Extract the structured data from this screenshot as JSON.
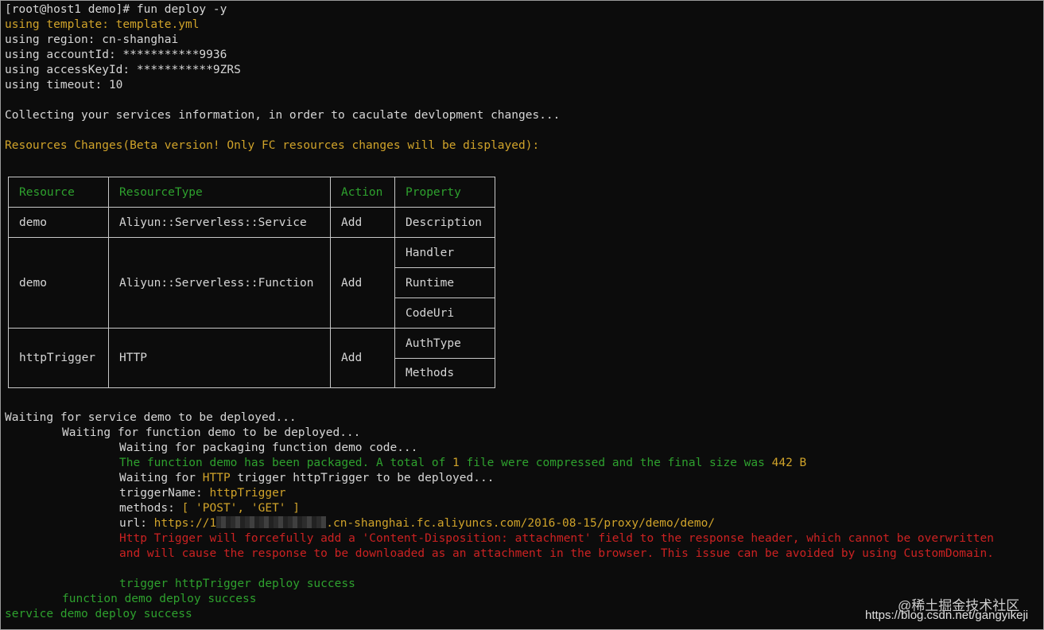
{
  "terminal": {
    "prompt": "[root@host1 demo]# fun deploy -y",
    "config_lines": [
      "using template: template.yml",
      "using region: cn-shanghai",
      "using accountId: ***********9936",
      "using accessKeyId: ***********9ZRS",
      "using timeout: 10"
    ],
    "collecting": "Collecting your services information, in order to caculate devlopment changes...",
    "resources_changes": "Resources Changes(Beta version! Only FC resources changes will be displayed):",
    "table": {
      "headers": [
        "Resource",
        "ResourceType",
        "Action",
        "Property"
      ],
      "rows": [
        {
          "resource": "demo",
          "type": "Aliyun::Serverless::Service",
          "action": "Add",
          "properties": [
            "Description"
          ]
        },
        {
          "resource": "demo",
          "type": "Aliyun::Serverless::Function",
          "action": "Add",
          "properties": [
            "Handler",
            "Runtime",
            "CodeUri"
          ]
        },
        {
          "resource": "httpTrigger",
          "type": "HTTP",
          "action": "Add",
          "properties": [
            "AuthType",
            "Methods"
          ]
        }
      ]
    },
    "deploy": {
      "wait_service": "Waiting for service demo to be deployed...",
      "wait_function": "Waiting for function demo to be deployed...",
      "wait_packaging": "Waiting for packaging function demo code...",
      "packaged_pre": "The function demo has been packaged. A total of ",
      "packaged_count": "1",
      "packaged_mid": " file were compressed and the final size was ",
      "packaged_size": "442 B",
      "wait_trigger_pre": "Waiting for ",
      "wait_trigger_type": "HTTP",
      "wait_trigger_post": " trigger httpTrigger to be deployed...",
      "trigger_name_label": "triggerName: ",
      "trigger_name_value": "httpTrigger",
      "methods_label": "methods: ",
      "methods_value": "[ 'POST', 'GET' ]",
      "url_label": "url: ",
      "url_prefix": "https://1",
      "url_suffix": ".cn-shanghai.fc.aliyuncs.com/2016-08-15/proxy/demo/demo/",
      "warning_1": "Http Trigger will forcefully add a 'Content-Disposition: attachment' field to the response header, which cannot be overwritten",
      "warning_2": "and will cause the response to be downloaded as an attachment in the browser. This issue can be avoided by using CustomDomain.",
      "trigger_success": "trigger httpTrigger deploy success",
      "function_success": "function demo deploy success",
      "service_success": "service demo deploy success"
    }
  },
  "watermark": {
    "site": "@稀土掘金技术社区",
    "url": "https://blog.csdn.net/gangyikeji"
  },
  "colors": {
    "background": "#0c0c0c",
    "text": "#d6d6d6",
    "yellow": "#d0a32a",
    "green": "#2ea12e",
    "red": "#cc2222"
  }
}
